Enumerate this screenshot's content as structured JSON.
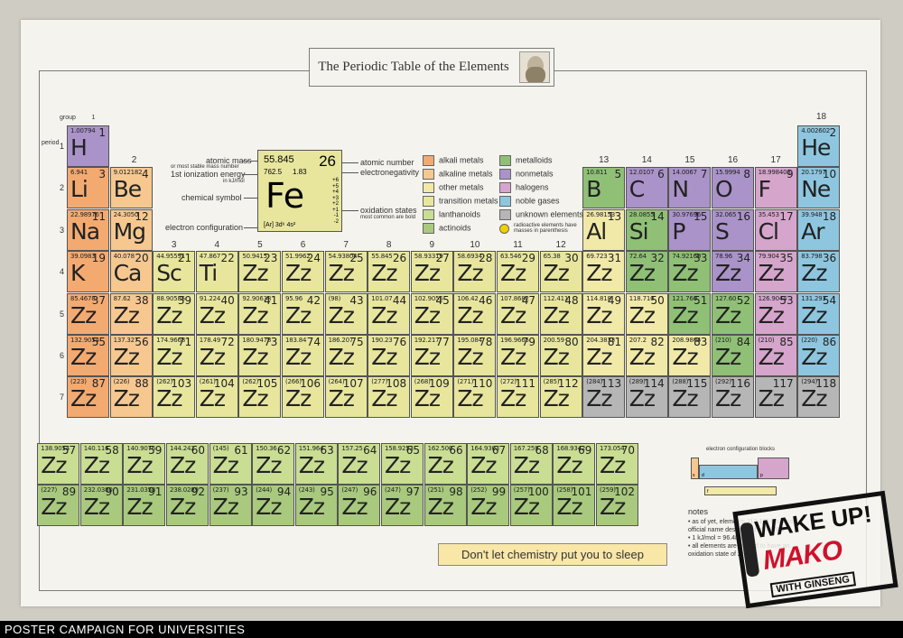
{
  "title": "The Periodic Table of the Elements",
  "labels": {
    "group": "group",
    "group1": "1",
    "group2": "2",
    "group18": "18",
    "period": "period"
  },
  "groups": [
    "3",
    "4",
    "5",
    "6",
    "7",
    "8",
    "9",
    "10",
    "11",
    "12",
    "13",
    "14",
    "15",
    "16",
    "17"
  ],
  "periods": [
    "1",
    "2",
    "3",
    "4",
    "5",
    "6",
    "7"
  ],
  "key": {
    "mass": "55.845",
    "number": "26",
    "ie": "762.5",
    "en": "1.83",
    "symbol": "Fe",
    "ox": [
      "+6",
      "+5",
      "+4",
      "+3",
      "+2",
      "+1",
      "-1",
      "-2"
    ],
    "ec": "[Ar] 3d⁶ 4s²",
    "lab_mass": "atomic mass",
    "lab_mass2": "or most stable mass number",
    "lab_ie": "1st ionization energy",
    "lab_ie2": "in kJ/mol",
    "lab_symbol": "chemical symbol",
    "lab_ec": "electron configuration",
    "lab_number": "atomic number",
    "lab_en": "electronegativity",
    "lab_ox": "oxidation states",
    "lab_ox2": "most common are bold"
  },
  "legend": [
    {
      "label": "alkali metals",
      "color": "#f3aa71"
    },
    {
      "label": "alkaline metals",
      "color": "#f6c890"
    },
    {
      "label": "other metals",
      "color": "#f1e9a7"
    },
    {
      "label": "transition metals",
      "color": "#e8e69d"
    },
    {
      "label": "lanthanoids",
      "color": "#c9dd93"
    },
    {
      "label": "actinoids",
      "color": "#a8c97e"
    },
    {
      "label": "metalloids",
      "color": "#8fc076"
    },
    {
      "label": "nonmetals",
      "color": "#aa93c8"
    },
    {
      "label": "halogens",
      "color": "#d5a5cc"
    },
    {
      "label": "noble gases",
      "color": "#8ec6df"
    },
    {
      "label": "unknown elements",
      "color": "#b6b6b6"
    },
    {
      "label": "radioactive elements have masses in parenthesis",
      "color": "#f0d000"
    }
  ],
  "elements": [
    {
      "n": "1",
      "m": "1.00794",
      "s": "H",
      "c": "non",
      "g": 1,
      "p": 1
    },
    {
      "n": "2",
      "m": "4.002602",
      "s": "He",
      "c": "nob",
      "g": 18,
      "p": 1
    },
    {
      "n": "3",
      "m": "6.941",
      "s": "Li",
      "c": "alk",
      "g": 1,
      "p": 2
    },
    {
      "n": "4",
      "m": "9.012182",
      "s": "Be",
      "c": "ale",
      "g": 2,
      "p": 2
    },
    {
      "n": "5",
      "m": "10.811",
      "s": "B",
      "c": "met",
      "g": 13,
      "p": 2
    },
    {
      "n": "6",
      "m": "12.0107",
      "s": "C",
      "c": "non",
      "g": 14,
      "p": 2
    },
    {
      "n": "7",
      "m": "14.0067",
      "s": "N",
      "c": "non",
      "g": 15,
      "p": 2
    },
    {
      "n": "8",
      "m": "15.9994",
      "s": "O",
      "c": "non",
      "g": 16,
      "p": 2
    },
    {
      "n": "9",
      "m": "18.998403",
      "s": "F",
      "c": "hal",
      "g": 17,
      "p": 2
    },
    {
      "n": "10",
      "m": "20.1797",
      "s": "Ne",
      "c": "nob",
      "g": 18,
      "p": 2
    },
    {
      "n": "11",
      "m": "22.98976",
      "s": "Na",
      "c": "alk",
      "g": 1,
      "p": 3
    },
    {
      "n": "12",
      "m": "24.3050",
      "s": "Mg",
      "c": "ale",
      "g": 2,
      "p": 3
    },
    {
      "n": "13",
      "m": "26.98153",
      "s": "Al",
      "c": "oth",
      "g": 13,
      "p": 3
    },
    {
      "n": "14",
      "m": "28.0855",
      "s": "Si",
      "c": "met",
      "g": 14,
      "p": 3
    },
    {
      "n": "15",
      "m": "30.97696",
      "s": "P",
      "c": "non",
      "g": 15,
      "p": 3
    },
    {
      "n": "16",
      "m": "32.065",
      "s": "S",
      "c": "non",
      "g": 16,
      "p": 3
    },
    {
      "n": "17",
      "m": "35.453",
      "s": "Cl",
      "c": "hal",
      "g": 17,
      "p": 3
    },
    {
      "n": "18",
      "m": "39.948",
      "s": "Ar",
      "c": "nob",
      "g": 18,
      "p": 3
    },
    {
      "n": "19",
      "m": "39.0983",
      "s": "K",
      "c": "alk",
      "g": 1,
      "p": 4
    },
    {
      "n": "20",
      "m": "40.078",
      "s": "Ca",
      "c": "ale",
      "g": 2,
      "p": 4
    },
    {
      "n": "21",
      "m": "44.95591",
      "s": "Sc",
      "c": "trn",
      "g": 3,
      "p": 4
    },
    {
      "n": "22",
      "m": "47.867",
      "s": "Ti",
      "c": "trn",
      "g": 4,
      "p": 4
    },
    {
      "n": "23",
      "m": "50.9415",
      "s": "Zz",
      "c": "trn",
      "g": 5,
      "p": 4
    },
    {
      "n": "24",
      "m": "51.9962",
      "s": "Zz",
      "c": "trn",
      "g": 6,
      "p": 4
    },
    {
      "n": "25",
      "m": "54.93804",
      "s": "Zz",
      "c": "trn",
      "g": 7,
      "p": 4
    },
    {
      "n": "26",
      "m": "55.845",
      "s": "Zz",
      "c": "trn",
      "g": 8,
      "p": 4
    },
    {
      "n": "27",
      "m": "58.93319",
      "s": "Zz",
      "c": "trn",
      "g": 9,
      "p": 4
    },
    {
      "n": "28",
      "m": "58.6934",
      "s": "Zz",
      "c": "trn",
      "g": 10,
      "p": 4
    },
    {
      "n": "29",
      "m": "63.546",
      "s": "Zz",
      "c": "trn",
      "g": 11,
      "p": 4
    },
    {
      "n": "30",
      "m": "65.38",
      "s": "Zz",
      "c": "trn",
      "g": 12,
      "p": 4
    },
    {
      "n": "31",
      "m": "69.723",
      "s": "Zz",
      "c": "oth",
      "g": 13,
      "p": 4
    },
    {
      "n": "32",
      "m": "72.64",
      "s": "Zz",
      "c": "met",
      "g": 14,
      "p": 4
    },
    {
      "n": "33",
      "m": "74.92160",
      "s": "Zz",
      "c": "met",
      "g": 15,
      "p": 4
    },
    {
      "n": "34",
      "m": "78.96",
      "s": "Zz",
      "c": "non",
      "g": 16,
      "p": 4
    },
    {
      "n": "35",
      "m": "79.904",
      "s": "Zz",
      "c": "hal",
      "g": 17,
      "p": 4
    },
    {
      "n": "36",
      "m": "83.798",
      "s": "Zz",
      "c": "nob",
      "g": 18,
      "p": 4
    },
    {
      "n": "37",
      "m": "85.4678",
      "s": "Zz",
      "c": "alk",
      "g": 1,
      "p": 5
    },
    {
      "n": "38",
      "m": "87.62",
      "s": "Zz",
      "c": "ale",
      "g": 2,
      "p": 5
    },
    {
      "n": "39",
      "m": "88.90585",
      "s": "Zz",
      "c": "trn",
      "g": 3,
      "p": 5
    },
    {
      "n": "40",
      "m": "91.224",
      "s": "Zz",
      "c": "trn",
      "g": 4,
      "p": 5
    },
    {
      "n": "41",
      "m": "92.90638",
      "s": "Zz",
      "c": "trn",
      "g": 5,
      "p": 5
    },
    {
      "n": "42",
      "m": "95.96",
      "s": "Zz",
      "c": "trn",
      "g": 6,
      "p": 5
    },
    {
      "n": "43",
      "m": "(98)",
      "s": "Zz",
      "c": "trn",
      "g": 7,
      "p": 5
    },
    {
      "n": "44",
      "m": "101.07",
      "s": "Zz",
      "c": "trn",
      "g": 8,
      "p": 5
    },
    {
      "n": "45",
      "m": "102.9055",
      "s": "Zz",
      "c": "trn",
      "g": 9,
      "p": 5
    },
    {
      "n": "46",
      "m": "106.42",
      "s": "Zz",
      "c": "trn",
      "g": 10,
      "p": 5
    },
    {
      "n": "47",
      "m": "107.8682",
      "s": "Zz",
      "c": "trn",
      "g": 11,
      "p": 5
    },
    {
      "n": "48",
      "m": "112.411",
      "s": "Zz",
      "c": "trn",
      "g": 12,
      "p": 5
    },
    {
      "n": "49",
      "m": "114.818",
      "s": "Zz",
      "c": "oth",
      "g": 13,
      "p": 5
    },
    {
      "n": "50",
      "m": "118.710",
      "s": "Zz",
      "c": "oth",
      "g": 14,
      "p": 5
    },
    {
      "n": "51",
      "m": "121.760",
      "s": "Zz",
      "c": "met",
      "g": 15,
      "p": 5
    },
    {
      "n": "52",
      "m": "127.60",
      "s": "Zz",
      "c": "met",
      "g": 16,
      "p": 5
    },
    {
      "n": "53",
      "m": "126.9044",
      "s": "Zz",
      "c": "hal",
      "g": 17,
      "p": 5
    },
    {
      "n": "54",
      "m": "131.293",
      "s": "Zz",
      "c": "nob",
      "g": 18,
      "p": 5
    },
    {
      "n": "55",
      "m": "132.9054",
      "s": "Zz",
      "c": "alk",
      "g": 1,
      "p": 6
    },
    {
      "n": "56",
      "m": "137.327",
      "s": "Zz",
      "c": "ale",
      "g": 2,
      "p": 6
    },
    {
      "n": "71",
      "m": "174.9668",
      "s": "Zz",
      "c": "trn",
      "g": 3,
      "p": 6
    },
    {
      "n": "72",
      "m": "178.49",
      "s": "Zz",
      "c": "trn",
      "g": 4,
      "p": 6
    },
    {
      "n": "73",
      "m": "180.9478",
      "s": "Zz",
      "c": "trn",
      "g": 5,
      "p": 6
    },
    {
      "n": "74",
      "m": "183.84",
      "s": "Zz",
      "c": "trn",
      "g": 6,
      "p": 6
    },
    {
      "n": "75",
      "m": "186.207",
      "s": "Zz",
      "c": "trn",
      "g": 7,
      "p": 6
    },
    {
      "n": "76",
      "m": "190.23",
      "s": "Zz",
      "c": "trn",
      "g": 8,
      "p": 6
    },
    {
      "n": "77",
      "m": "192.217",
      "s": "Zz",
      "c": "trn",
      "g": 9,
      "p": 6
    },
    {
      "n": "78",
      "m": "195.084",
      "s": "Zz",
      "c": "trn",
      "g": 10,
      "p": 6
    },
    {
      "n": "79",
      "m": "196.9665",
      "s": "Zz",
      "c": "trn",
      "g": 11,
      "p": 6
    },
    {
      "n": "80",
      "m": "200.59",
      "s": "Zz",
      "c": "trn",
      "g": 12,
      "p": 6
    },
    {
      "n": "81",
      "m": "204.3833",
      "s": "Zz",
      "c": "oth",
      "g": 13,
      "p": 6
    },
    {
      "n": "82",
      "m": "207.2",
      "s": "Zz",
      "c": "oth",
      "g": 14,
      "p": 6
    },
    {
      "n": "83",
      "m": "208.9804",
      "s": "Zz",
      "c": "oth",
      "g": 15,
      "p": 6
    },
    {
      "n": "84",
      "m": "(210)",
      "s": "Zz",
      "c": "met",
      "g": 16,
      "p": 6
    },
    {
      "n": "85",
      "m": "(210)",
      "s": "Zz",
      "c": "hal",
      "g": 17,
      "p": 6
    },
    {
      "n": "86",
      "m": "(220)",
      "s": "Zz",
      "c": "nob",
      "g": 18,
      "p": 6
    },
    {
      "n": "87",
      "m": "(223)",
      "s": "Zz",
      "c": "alk",
      "g": 1,
      "p": 7
    },
    {
      "n": "88",
      "m": "(226)",
      "s": "Zz",
      "c": "ale",
      "g": 2,
      "p": 7
    },
    {
      "n": "103",
      "m": "(262)",
      "s": "Zz",
      "c": "trn",
      "g": 3,
      "p": 7
    },
    {
      "n": "104",
      "m": "(261)",
      "s": "Zz",
      "c": "trn",
      "g": 4,
      "p": 7
    },
    {
      "n": "105",
      "m": "(262)",
      "s": "Zz",
      "c": "trn",
      "g": 5,
      "p": 7
    },
    {
      "n": "106",
      "m": "(266)",
      "s": "Zz",
      "c": "trn",
      "g": 6,
      "p": 7
    },
    {
      "n": "107",
      "m": "(264)",
      "s": "Zz",
      "c": "trn",
      "g": 7,
      "p": 7
    },
    {
      "n": "108",
      "m": "(277)",
      "s": "Zz",
      "c": "trn",
      "g": 8,
      "p": 7
    },
    {
      "n": "109",
      "m": "(268)",
      "s": "Zz",
      "c": "trn",
      "g": 9,
      "p": 7
    },
    {
      "n": "110",
      "m": "(271)",
      "s": "Zz",
      "c": "trn",
      "g": 10,
      "p": 7
    },
    {
      "n": "111",
      "m": "(272)",
      "s": "Zz",
      "c": "trn",
      "g": 11,
      "p": 7
    },
    {
      "n": "112",
      "m": "(285)",
      "s": "Zz",
      "c": "trn",
      "g": 12,
      "p": 7
    },
    {
      "n": "113",
      "m": "(284)",
      "s": "Zz",
      "c": "unk",
      "g": 13,
      "p": 7
    },
    {
      "n": "114",
      "m": "(289)",
      "s": "Zz",
      "c": "unk",
      "g": 14,
      "p": 7
    },
    {
      "n": "115",
      "m": "(288)",
      "s": "Zz",
      "c": "unk",
      "g": 15,
      "p": 7
    },
    {
      "n": "116",
      "m": "(292)",
      "s": "Zz",
      "c": "unk",
      "g": 16,
      "p": 7
    },
    {
      "n": "117",
      "m": "",
      "s": "Zz",
      "c": "unk",
      "g": 17,
      "p": 7
    },
    {
      "n": "118",
      "m": "(294)",
      "s": "Zz",
      "c": "unk",
      "g": 18,
      "p": 7
    }
  ],
  "lanthanoids": [
    {
      "n": "57",
      "m": "138.9054"
    },
    {
      "n": "58",
      "m": "140.116"
    },
    {
      "n": "59",
      "m": "140.9076"
    },
    {
      "n": "60",
      "m": "144.242"
    },
    {
      "n": "61",
      "m": "(145)"
    },
    {
      "n": "62",
      "m": "150.36"
    },
    {
      "n": "63",
      "m": "151.964"
    },
    {
      "n": "64",
      "m": "157.25"
    },
    {
      "n": "65",
      "m": "158.9253"
    },
    {
      "n": "66",
      "m": "162.500"
    },
    {
      "n": "67",
      "m": "164.9303"
    },
    {
      "n": "68",
      "m": "167.259"
    },
    {
      "n": "69",
      "m": "168.9342"
    },
    {
      "n": "70",
      "m": "173.054"
    }
  ],
  "actinoids": [
    {
      "n": "89",
      "m": "(227)"
    },
    {
      "n": "90",
      "m": "232.0380"
    },
    {
      "n": "91",
      "m": "231.0358"
    },
    {
      "n": "92",
      "m": "238.0289"
    },
    {
      "n": "93",
      "m": "(237)"
    },
    {
      "n": "94",
      "m": "(244)"
    },
    {
      "n": "95",
      "m": "(243)"
    },
    {
      "n": "96",
      "m": "(247)"
    },
    {
      "n": "97",
      "m": "(247)"
    },
    {
      "n": "98",
      "m": "(251)"
    },
    {
      "n": "99",
      "m": "(252)"
    },
    {
      "n": "100",
      "m": "(257)"
    },
    {
      "n": "101",
      "m": "(258)"
    },
    {
      "n": "102",
      "m": "(259)"
    }
  ],
  "fblock_symbol": "Zz",
  "blocks_title": "electron configuration blocks",
  "blocks": [
    "s",
    "d",
    "p",
    "f"
  ],
  "tagline": "Don't let chemistry put you to sleep",
  "notes": {
    "title": "notes",
    "items": [
      "• as of yet, elements 113-118 have no official name designated by IUPAC",
      "• 1 kJ/mol = 96.485 eV",
      "• all elements are implied to have an oxidation state of zero"
    ]
  },
  "stamp": {
    "wake": "WAKE UP!",
    "brand": "MAKO",
    "ginseng": "WITH GINSENG"
  },
  "footer": "POSTER CAMPAIGN FOR UNIVERSITIES"
}
